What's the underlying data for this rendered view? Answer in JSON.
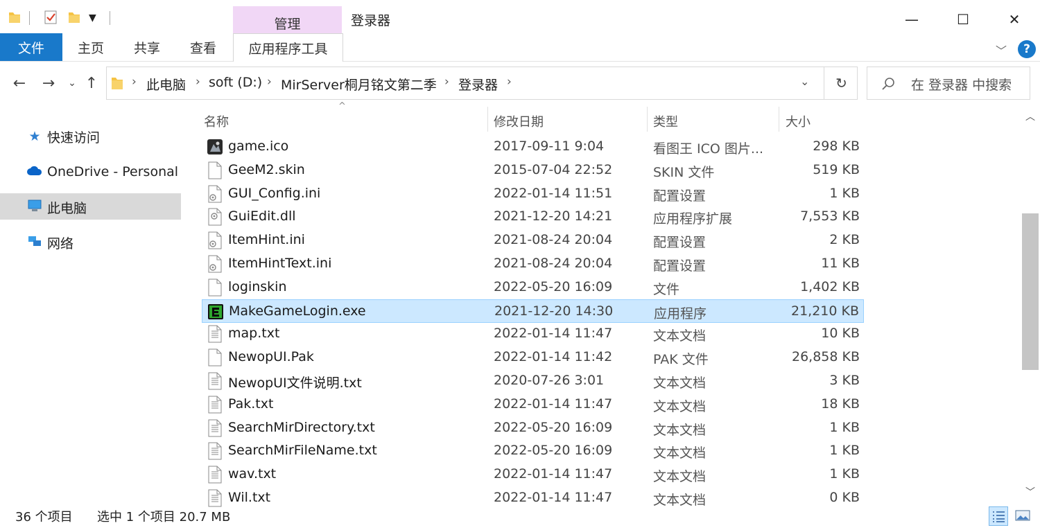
{
  "window": {
    "title": "登录器",
    "context_tab_label": "管理",
    "controls": {
      "minimize": "—",
      "maximize": "☐",
      "close": "✕"
    }
  },
  "ribbon": {
    "tabs": [
      "文件",
      "主页",
      "共享",
      "查看",
      "应用程序工具"
    ],
    "help_label": "?"
  },
  "address": {
    "crumbs": [
      "此电脑",
      "soft (D:)",
      "MirServer桐月铭文第二季",
      "登录器"
    ],
    "search_placeholder": "在 登录器 中搜索"
  },
  "nav_pane": {
    "items": [
      {
        "label": "快速访问",
        "icon": "star-icon"
      },
      {
        "label": "OneDrive - Personal",
        "icon": "cloud-icon"
      },
      {
        "label": "此电脑",
        "icon": "computer-icon",
        "selected": true
      },
      {
        "label": "网络",
        "icon": "network-icon"
      }
    ]
  },
  "columns": {
    "name": "名称",
    "date": "修改日期",
    "type": "类型",
    "size": "大小"
  },
  "files": [
    {
      "name": "game.ico",
      "date": "2017-09-11 9:04",
      "type": "看图王 ICO 图片...",
      "size": "298 KB",
      "icon": "ico-image-icon"
    },
    {
      "name": "GeeM2.skin",
      "date": "2015-07-04 22:52",
      "type": "SKIN 文件",
      "size": "519 KB",
      "icon": "blank-file-icon"
    },
    {
      "name": "GUI_Config.ini",
      "date": "2022-01-14 11:51",
      "type": "配置设置",
      "size": "1 KB",
      "icon": "config-file-icon"
    },
    {
      "name": "GuiEdit.dll",
      "date": "2021-12-20 14:21",
      "type": "应用程序扩展",
      "size": "7,553 KB",
      "icon": "dll-file-icon"
    },
    {
      "name": "ItemHint.ini",
      "date": "2021-08-24 20:04",
      "type": "配置设置",
      "size": "2 KB",
      "icon": "config-file-icon"
    },
    {
      "name": "ItemHintText.ini",
      "date": "2021-08-24 20:04",
      "type": "配置设置",
      "size": "11 KB",
      "icon": "config-file-icon"
    },
    {
      "name": "loginskin",
      "date": "2022-05-20 16:09",
      "type": "文件",
      "size": "1,402 KB",
      "icon": "blank-file-icon"
    },
    {
      "name": "MakeGameLogin.exe",
      "date": "2021-12-20 14:30",
      "type": "应用程序",
      "size": "21,210 KB",
      "icon": "exe-app-icon",
      "selected": true
    },
    {
      "name": "map.txt",
      "date": "2022-01-14 11:47",
      "type": "文本文档",
      "size": "10 KB",
      "icon": "text-file-icon"
    },
    {
      "name": "NewopUI.Pak",
      "date": "2022-01-14 11:42",
      "type": "PAK 文件",
      "size": "26,858 KB",
      "icon": "blank-file-icon"
    },
    {
      "name": "NewopUI文件说明.txt",
      "date": "2020-07-26 3:01",
      "type": "文本文档",
      "size": "3 KB",
      "icon": "text-file-icon"
    },
    {
      "name": "Pak.txt",
      "date": "2022-01-14 11:47",
      "type": "文本文档",
      "size": "18 KB",
      "icon": "text-file-icon"
    },
    {
      "name": "SearchMirDirectory.txt",
      "date": "2022-05-20 16:09",
      "type": "文本文档",
      "size": "1 KB",
      "icon": "text-file-icon"
    },
    {
      "name": "SearchMirFileName.txt",
      "date": "2022-05-20 16:09",
      "type": "文本文档",
      "size": "1 KB",
      "icon": "text-file-icon"
    },
    {
      "name": "wav.txt",
      "date": "2022-01-14 11:47",
      "type": "文本文档",
      "size": "1 KB",
      "icon": "text-file-icon"
    },
    {
      "name": "Wil.txt",
      "date": "2022-01-14 11:47",
      "type": "文本文档",
      "size": "0 KB",
      "icon": "text-file-icon"
    }
  ],
  "status": {
    "item_count": "36 个项目",
    "selection": "选中 1 个项目  20.7 MB"
  },
  "colors": {
    "accent": "#1979ca",
    "context_tab": "#f1d7f6",
    "selection_bg": "#cce8ff",
    "selection_border": "#99d1ff",
    "nav_selected": "#d9d9d9"
  }
}
